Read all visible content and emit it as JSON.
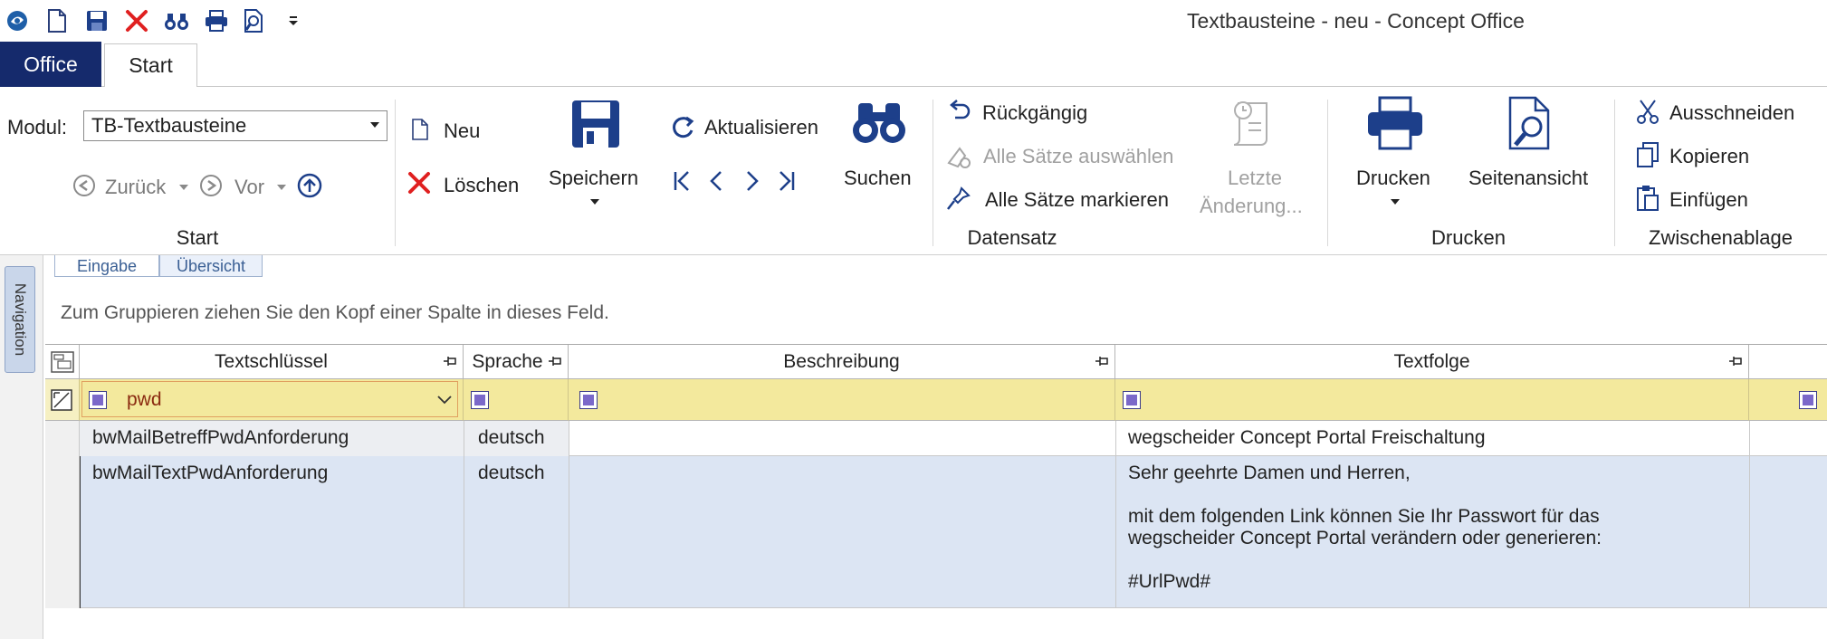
{
  "window": {
    "title": "Textbausteine - neu - Concept Office"
  },
  "quick_access": [
    {
      "name": "app-logo-icon"
    },
    {
      "name": "new-doc-icon"
    },
    {
      "name": "save-icon"
    },
    {
      "name": "delete-icon"
    },
    {
      "name": "binoculars-icon"
    },
    {
      "name": "print-icon"
    },
    {
      "name": "preview-icon"
    },
    {
      "name": "customize-dropdown-icon"
    }
  ],
  "tabs": {
    "office": "Office",
    "start": "Start"
  },
  "ribbon": {
    "start_group": {
      "modul_label": "Modul:",
      "modul_value": "TB-Textbausteine",
      "back": "Zurück",
      "forward": "Vor",
      "label": "Start"
    },
    "datensatz_group": {
      "neu": "Neu",
      "loeschen": "Löschen",
      "speichern": "Speichern",
      "aktualisieren": "Aktualisieren",
      "suchen": "Suchen",
      "rueckgaengig": "Rückgängig",
      "alle_auswaehlen": "Alle Sätze auswählen",
      "alle_markieren": "Alle Sätze markieren",
      "letzte_1": "Letzte",
      "letzte_2": "Änderung...",
      "label": "Datensatz"
    },
    "drucken_group": {
      "drucken": "Drucken",
      "seitenansicht": "Seitenansicht",
      "label": "Drucken"
    },
    "zwischenablage_group": {
      "ausschneiden": "Ausschneiden",
      "kopieren": "Kopieren",
      "einfuegen": "Einfügen",
      "label": "Zwischenablage"
    }
  },
  "nav_strip": {
    "label": "Navigation"
  },
  "subtabs": {
    "eingabe": "Eingabe",
    "uebersicht": "Übersicht"
  },
  "group_panel": {
    "hint": "Zum Gruppieren ziehen Sie den Kopf einer Spalte in dieses Feld."
  },
  "grid": {
    "columns": [
      "Textschlüssel",
      "Sprache",
      "Beschreibung",
      "Textfolge"
    ],
    "filter_value": "pwd",
    "rows": [
      {
        "schluessel": "bwMailBetreffPwdAnforderung",
        "sprache": "deutsch",
        "beschreibung": "",
        "textfolge": "wegscheider Concept Portal Freischaltung"
      },
      {
        "schluessel": "bwMailTextPwdAnforderung",
        "sprache": "deutsch",
        "beschreibung": "",
        "textfolge": "Sehr geehrte Damen und Herren,\n\nmit dem folgenden Link können Sie Ihr Passwort für das\nwegscheider Concept Portal verändern oder generieren:\n\n#UrlPwd#"
      }
    ]
  },
  "colors": {
    "office_tab": "#152a6c",
    "filter_row": "#f3e99d",
    "selected_row": "#dce5f3",
    "accent": "#1f5fa8"
  }
}
